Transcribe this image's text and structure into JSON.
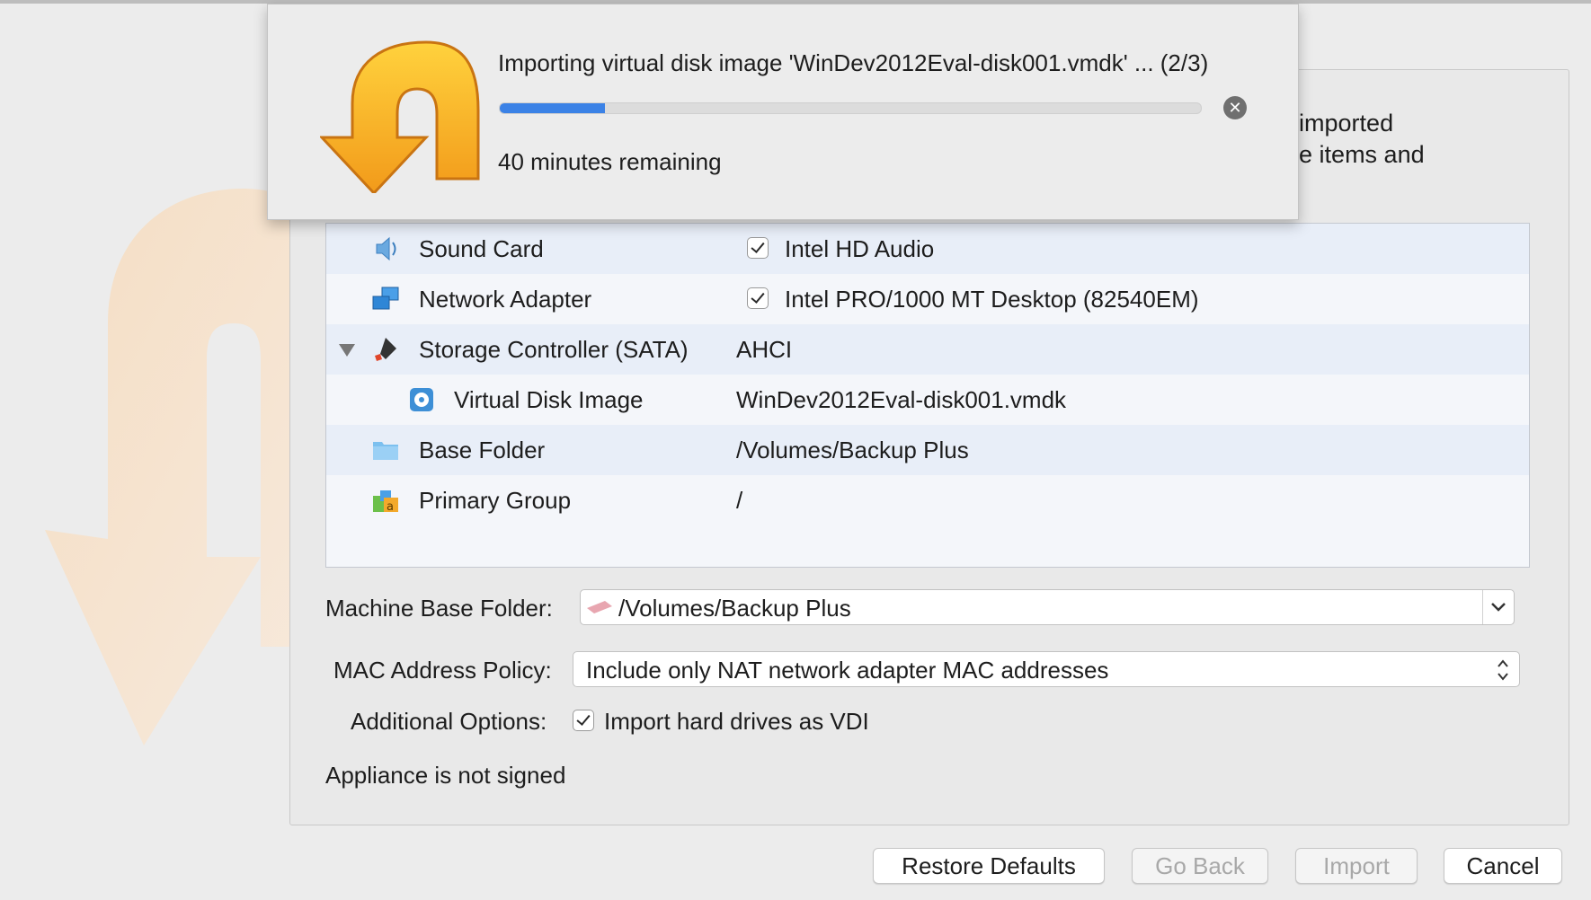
{
  "popup": {
    "title": "Importing virtual disk image 'WinDev2012Eval-disk001.vmdk' ... (2/3)",
    "progress_fraction": 0.15,
    "remaining": "40 minutes remaining",
    "icon": "import-arrow-icon",
    "cancel_icon": "close-circle-icon"
  },
  "description": {
    "line1": "the imported",
    "line2": "n the items and"
  },
  "appliance": {
    "rows": [
      {
        "label": "Sound Card",
        "value": "Intel HD Audio",
        "icon": "sound-card-icon",
        "checked": true
      },
      {
        "label": "Network Adapter",
        "value": "Intel PRO/1000 MT Desktop (82540EM)",
        "icon": "network-adapter-icon",
        "checked": true
      },
      {
        "label": "Storage Controller (SATA)",
        "value": "AHCI",
        "icon": "storage-controller-icon",
        "expanded": true
      },
      {
        "label": "Virtual Disk Image",
        "value": "WinDev2012Eval-disk001.vmdk",
        "icon": "disk-image-icon"
      },
      {
        "label": "Base Folder",
        "value": "/Volumes/Backup Plus",
        "icon": "folder-icon"
      },
      {
        "label": "Primary Group",
        "value": "/",
        "icon": "group-icon"
      }
    ]
  },
  "form": {
    "machine_base_folder_label": "Machine Base Folder:",
    "machine_base_folder_value": "/Volumes/Backup Plus",
    "mac_policy_label": "MAC Address Policy:",
    "mac_policy_value": "Include only NAT network adapter MAC addresses",
    "additional_options_label": "Additional Options:",
    "import_vdi_label": "Import hard drives as VDI",
    "import_vdi_checked": true,
    "signature_status": "Appliance is not signed"
  },
  "buttons": {
    "restore_defaults": "Restore Defaults",
    "go_back": "Go Back",
    "import": "Import",
    "cancel": "Cancel"
  },
  "colors": {
    "progress": "#3b82e6",
    "arrow_orange": "#f6a623",
    "row_alt": "#e8eef8"
  }
}
